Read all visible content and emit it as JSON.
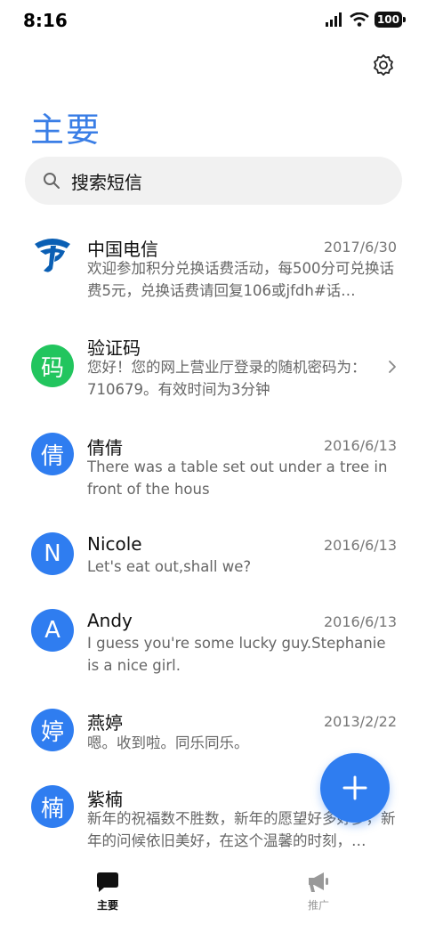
{
  "status_bar": {
    "time": "8:16",
    "battery": "100"
  },
  "header": {
    "title": "主要"
  },
  "search": {
    "placeholder": "搜索短信"
  },
  "messages": [
    {
      "sender": "中国电信",
      "date": "2017/6/30",
      "preview": "欢迎参加积分兑换话费活动，每500分可兑换话费5元，兑换话费请回复106或jfdh#话…",
      "avatar_type": "logo"
    },
    {
      "sender": "验证码",
      "date": "",
      "preview": "您好！您的网上营业厅登录的随机密码为：710679。有效时间为3分钟",
      "avatar_text": "码",
      "avatar_color": "#22c55e"
    },
    {
      "sender": "倩倩",
      "date": "2016/6/13",
      "preview": "There was a table set out under a tree in front of the hous",
      "avatar_text": "倩",
      "avatar_color": "#2f7df0"
    },
    {
      "sender": "Nicole",
      "date": "2016/6/13",
      "preview": "Let's eat out,shall we?",
      "avatar_text": "N",
      "avatar_color": "#2f7df0"
    },
    {
      "sender": "Andy",
      "date": "2016/6/13",
      "preview": "I guess you're some lucky guy.Stephanie is a nice girl.",
      "avatar_text": "A",
      "avatar_color": "#2f7df0"
    },
    {
      "sender": "燕婷",
      "date": "2013/2/22",
      "preview": "嗯。收到啦。同乐同乐。",
      "avatar_text": "婷",
      "avatar_color": "#2f7df0"
    },
    {
      "sender": "紫楠",
      "date": "",
      "preview": "新年的祝福数不胜数，新年的愿望好多好多，新年的问候依旧美好，在这个温馨的时刻，…",
      "avatar_text": "楠",
      "avatar_color": "#2f7df0"
    }
  ],
  "nav": {
    "home_label": "主要",
    "promo_label": "推广"
  },
  "colors": {
    "accent": "#2f7df0",
    "title": "#3a7ee6",
    "verify_green": "#22c55e"
  }
}
